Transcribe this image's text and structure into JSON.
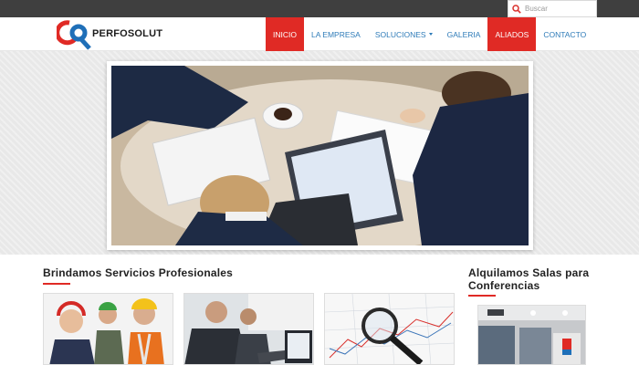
{
  "search": {
    "placeholder": "Buscar",
    "icon": "search-icon"
  },
  "brand": {
    "name": "PERFOSOLUT",
    "colors": {
      "red": "#e02a25",
      "blue": "#1f6fb8"
    }
  },
  "nav": {
    "items": [
      {
        "label": "INICIO",
        "active": true
      },
      {
        "label": "LA EMPRESA"
      },
      {
        "label": "SOLUCIONES",
        "has_dropdown": true
      },
      {
        "label": "GALERIA"
      },
      {
        "label": "ALIADOS",
        "active": true
      },
      {
        "label": "CONTACTO"
      }
    ]
  },
  "sections": {
    "services_title": "Brindamos Servicios Profesionales",
    "rooms_title_line1": "Alquilamos Salas para",
    "rooms_title_line2": "Conferencias"
  },
  "colors": {
    "topbar": "#3f3f3f",
    "accent": "#e02a25",
    "nav_text": "#2e7bb8"
  }
}
